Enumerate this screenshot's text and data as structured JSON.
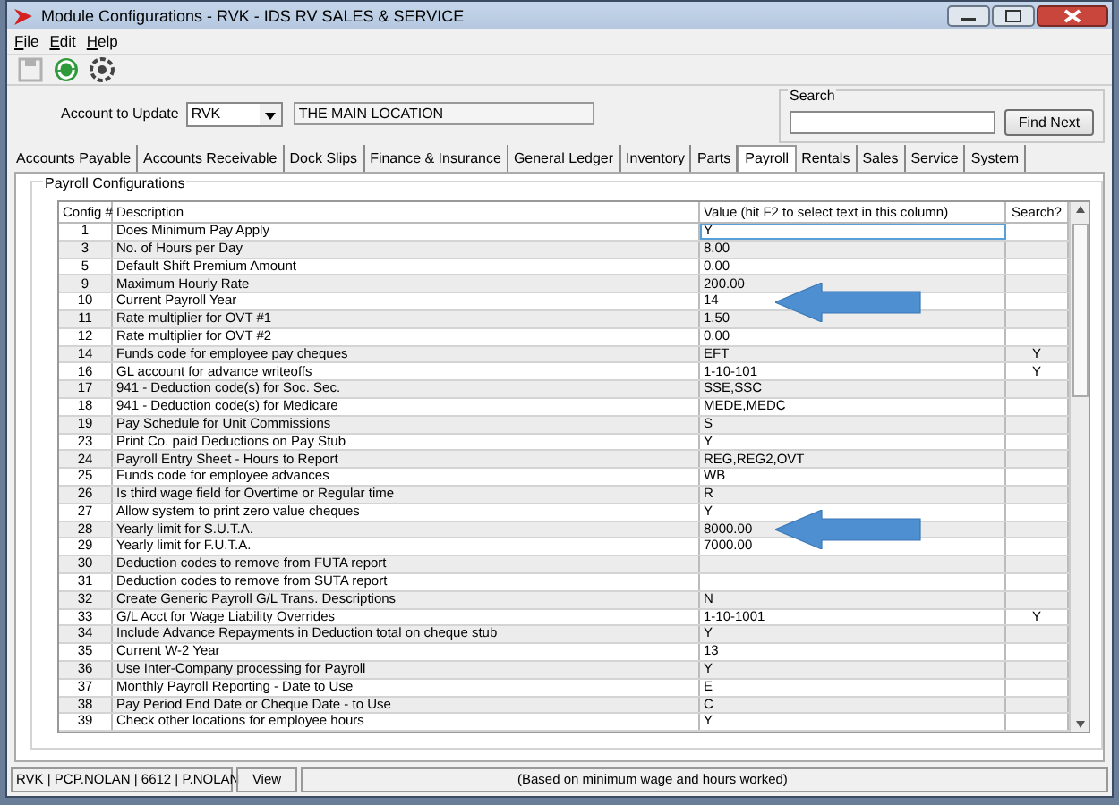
{
  "window": {
    "title": "Module Configurations - RVK - IDS RV SALES & SERVICE"
  },
  "menu": [
    {
      "label": "File"
    },
    {
      "label": "Edit"
    },
    {
      "label": "Help"
    }
  ],
  "toolbar": [
    {
      "kind": "save",
      "disabled": true
    },
    {
      "kind": "refresh",
      "disabled": false
    },
    {
      "kind": "settings",
      "disabled": false
    }
  ],
  "account": {
    "label": "Account to Update",
    "value": "RVK",
    "location": "THE MAIN LOCATION"
  },
  "search": {
    "legend": "Search",
    "button": "Find Next"
  },
  "tabs": [
    {
      "label": "Accounts Payable",
      "selected": false
    },
    {
      "label": "Accounts Receivable",
      "selected": false
    },
    {
      "label": "Dock Slips",
      "selected": false
    },
    {
      "label": "Finance & Insurance",
      "selected": false
    },
    {
      "label": "General Ledger",
      "selected": false
    },
    {
      "label": "Inventory",
      "selected": false
    },
    {
      "label": "Parts",
      "selected": false
    },
    {
      "label": "Payroll",
      "selected": true
    },
    {
      "label": "Rentals",
      "selected": false
    },
    {
      "label": "Sales",
      "selected": false
    },
    {
      "label": "Service",
      "selected": false
    },
    {
      "label": "System",
      "selected": false
    }
  ],
  "group": {
    "title": "Payroll Configurations"
  },
  "table": {
    "columns": [
      "Config #",
      "Description",
      "Value (hit F2 to select text in this column)",
      "Search?"
    ],
    "rows": [
      {
        "num": "1",
        "desc": "Does Minimum Pay Apply",
        "value": "Y",
        "search": "",
        "selected": true,
        "arrow": false
      },
      {
        "num": "3",
        "desc": "No. of Hours per Day",
        "value": "8.00",
        "search": "",
        "selected": false,
        "arrow": false
      },
      {
        "num": "5",
        "desc": "Default Shift Premium Amount",
        "value": "0.00",
        "search": "",
        "selected": false,
        "arrow": false
      },
      {
        "num": "9",
        "desc": "Maximum Hourly Rate",
        "value": "200.00",
        "search": "",
        "selected": false,
        "arrow": false
      },
      {
        "num": "10",
        "desc": "Current Payroll Year",
        "value": "14",
        "search": "",
        "selected": false,
        "arrow": true
      },
      {
        "num": "11",
        "desc": "Rate multiplier for OVT #1",
        "value": "1.50",
        "search": "",
        "selected": false,
        "arrow": false
      },
      {
        "num": "12",
        "desc": "Rate multiplier for OVT #2",
        "value": "0.00",
        "search": "",
        "selected": false,
        "arrow": false
      },
      {
        "num": "14",
        "desc": "Funds code for employee pay cheques",
        "value": "EFT",
        "search": "Y",
        "selected": false,
        "arrow": false
      },
      {
        "num": "16",
        "desc": "GL account for advance writeoffs",
        "value": "1-10-101",
        "search": "Y",
        "selected": false,
        "arrow": false
      },
      {
        "num": "17",
        "desc": "941 - Deduction code(s) for Soc. Sec.",
        "value": "SSE,SSC",
        "search": "",
        "selected": false,
        "arrow": false
      },
      {
        "num": "18",
        "desc": "941 - Deduction code(s) for Medicare",
        "value": "MEDE,MEDC",
        "search": "",
        "selected": false,
        "arrow": false
      },
      {
        "num": "19",
        "desc": "Pay Schedule for Unit Commissions",
        "value": "S",
        "search": "",
        "selected": false,
        "arrow": false
      },
      {
        "num": "23",
        "desc": "Print Co. paid Deductions on Pay Stub",
        "value": "Y",
        "search": "",
        "selected": false,
        "arrow": false
      },
      {
        "num": "24",
        "desc": "Payroll Entry Sheet - Hours to Report",
        "value": "REG,REG2,OVT",
        "search": "",
        "selected": false,
        "arrow": false
      },
      {
        "num": "25",
        "desc": "Funds code for employee advances",
        "value": "WB",
        "search": "",
        "selected": false,
        "arrow": false
      },
      {
        "num": "26",
        "desc": "Is third wage field for Overtime or Regular time",
        "value": "R",
        "search": "",
        "selected": false,
        "arrow": false
      },
      {
        "num": "27",
        "desc": "Allow system to print zero value cheques",
        "value": "Y",
        "search": "",
        "selected": false,
        "arrow": false
      },
      {
        "num": "28",
        "desc": "Yearly limit for S.U.T.A.",
        "value": "8000.00",
        "search": "",
        "selected": false,
        "arrow": true
      },
      {
        "num": "29",
        "desc": "Yearly limit for F.U.T.A.",
        "value": "7000.00",
        "search": "",
        "selected": false,
        "arrow": false
      },
      {
        "num": "30",
        "desc": "Deduction codes to remove from FUTA report",
        "value": "",
        "search": "",
        "selected": false,
        "arrow": false
      },
      {
        "num": "31",
        "desc": "Deduction codes to remove from SUTA report",
        "value": "",
        "search": "",
        "selected": false,
        "arrow": false
      },
      {
        "num": "32",
        "desc": "Create Generic Payroll G/L Trans. Descriptions",
        "value": "N",
        "search": "",
        "selected": false,
        "arrow": false
      },
      {
        "num": "33",
        "desc": "G/L Acct for Wage Liability Overrides",
        "value": "1-10-1001",
        "search": "Y",
        "selected": false,
        "arrow": false
      },
      {
        "num": "34",
        "desc": "Include Advance Repayments in Deduction total on cheque stub",
        "value": "Y",
        "search": "",
        "selected": false,
        "arrow": false
      },
      {
        "num": "35",
        "desc": "Current W-2 Year",
        "value": "13",
        "search": "",
        "selected": false,
        "arrow": false
      },
      {
        "num": "36",
        "desc": "Use Inter-Company processing for Payroll",
        "value": "Y",
        "search": "",
        "selected": false,
        "arrow": false
      },
      {
        "num": "37",
        "desc": "Monthly Payroll Reporting - Date to Use",
        "value": "E",
        "search": "",
        "selected": false,
        "arrow": false
      },
      {
        "num": "38",
        "desc": "Pay Period End Date or Cheque Date - to Use",
        "value": "C",
        "search": "",
        "selected": false,
        "arrow": false
      },
      {
        "num": "39",
        "desc": "Check other locations for employee hours",
        "value": "Y",
        "search": "",
        "selected": false,
        "arrow": false
      }
    ]
  },
  "status_bar": {
    "user": "RVK | PCP.NOLAN | 6612 | P.NOLAN",
    "mode": "View",
    "hint": "(Based on minimum wage and hours worked)"
  }
}
